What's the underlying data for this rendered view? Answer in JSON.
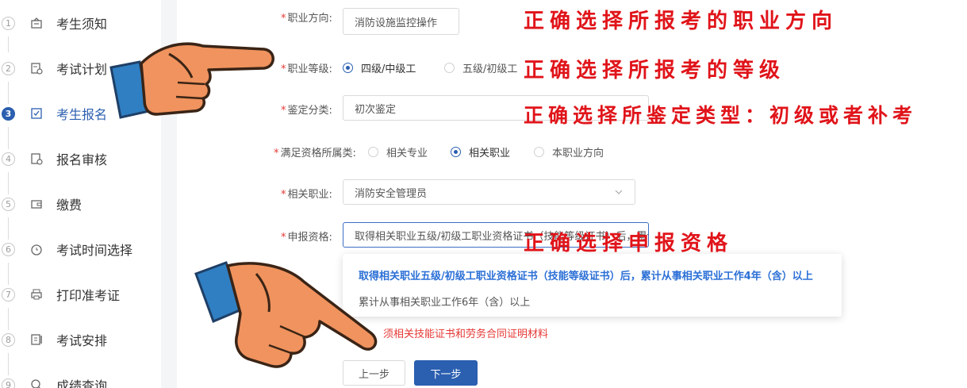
{
  "sidebar": {
    "steps": [
      {
        "num": "1",
        "label": "考生须知",
        "icon": "notice-icon"
      },
      {
        "num": "2",
        "label": "考试计划",
        "icon": "plan-icon"
      },
      {
        "num": "3",
        "label": "考生报名",
        "icon": "register-icon"
      },
      {
        "num": "4",
        "label": "报名审核",
        "icon": "review-icon"
      },
      {
        "num": "5",
        "label": "缴费",
        "icon": "wallet-icon"
      },
      {
        "num": "6",
        "label": "考试时间选择",
        "icon": "clock-icon"
      },
      {
        "num": "7",
        "label": "打印准考证",
        "icon": "printer-icon"
      },
      {
        "num": "8",
        "label": "考试安排",
        "icon": "schedule-icon"
      },
      {
        "num": "9",
        "label": "成绩查询",
        "icon": "search-icon"
      }
    ],
    "active_index": 2
  },
  "form": {
    "direction": {
      "label": "职业方向:",
      "value": "消防设施监控操作"
    },
    "level": {
      "label": "职业等级:",
      "options": [
        "四级/中级工",
        "五级/初级工"
      ],
      "selected": "四级/中级工"
    },
    "category": {
      "label": "鉴定分类:",
      "value": "初次鉴定"
    },
    "qualification_type": {
      "label": "满足资格所属类:",
      "options": [
        "相关专业",
        "相关职业",
        "本职业方向"
      ],
      "selected": "相关职业"
    },
    "related_job": {
      "label": "相关职业:",
      "value": "消防安全管理员"
    },
    "apply_qual": {
      "label": "申报资格:",
      "value": "取得相关职业五级/初级工职业资格证书（技能等级证书）后，累计从事相关职业工作4年（含）以上"
    },
    "dropdown_options": [
      "取得相关职业五级/初级工职业资格证书（技能等级证书）后，累计从事相关职业工作4年（含）以上",
      "累计从事相关职业工作6年（含）以上"
    ],
    "notice": "须相关技能证书和劳务合同证明材料"
  },
  "buttons": {
    "prev": "上一步",
    "next": "下一步"
  },
  "annotations": {
    "a1": "正确选择所报考的职业方向",
    "a2": "正确选择所报考的等级",
    "a3": "正确选择所鉴定类型：初级或者补考",
    "a4": "正确选择申报资格"
  },
  "colors": {
    "accent": "#2b5fb0",
    "annotation": "#e0141a",
    "required": "#e53935"
  }
}
